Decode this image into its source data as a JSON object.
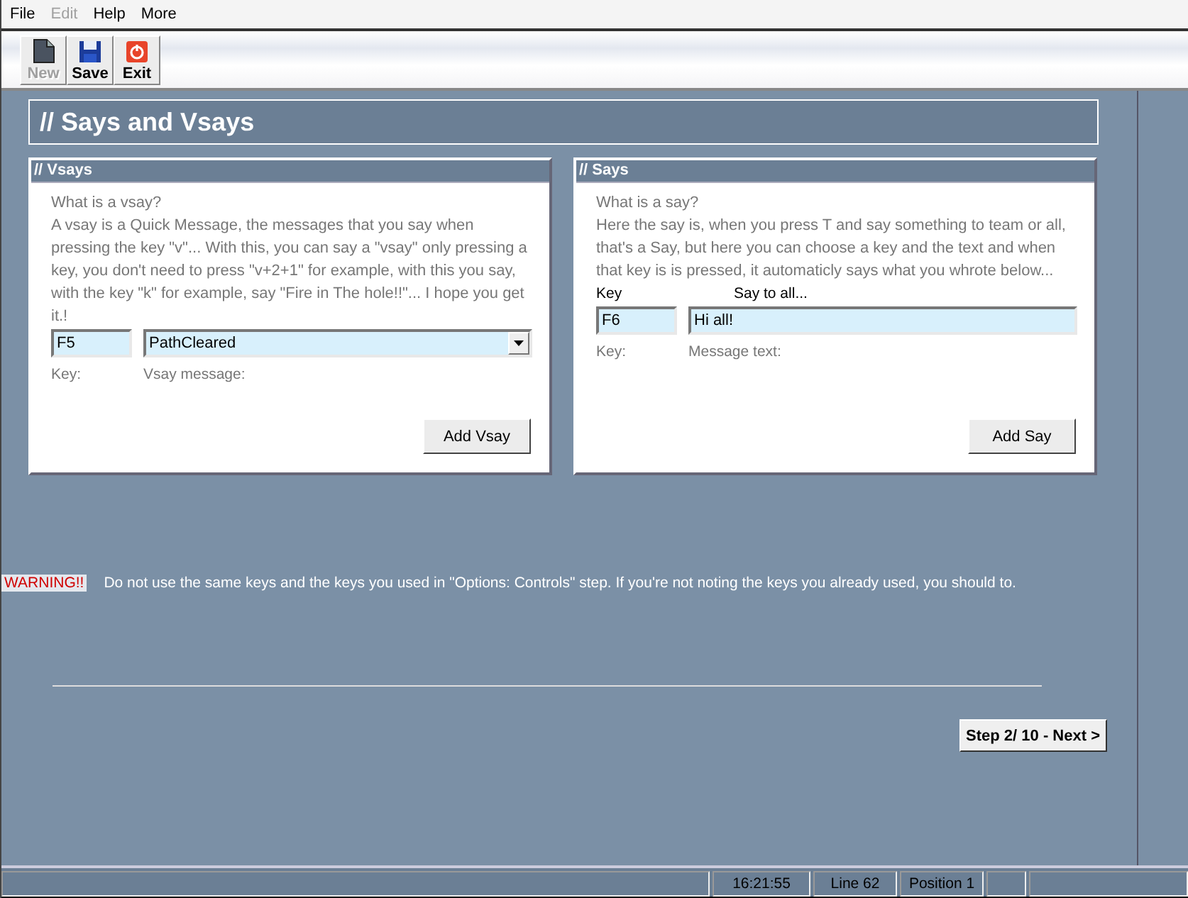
{
  "menu": [
    {
      "label": "File",
      "disabled": false
    },
    {
      "label": "Edit",
      "disabled": true
    },
    {
      "label": "Help",
      "disabled": false
    },
    {
      "label": "More",
      "disabled": false
    }
  ],
  "toolbar": [
    {
      "label": "New",
      "kind": "new",
      "disabled": true
    },
    {
      "label": "Save",
      "kind": "save",
      "disabled": false
    },
    {
      "label": "Exit",
      "kind": "exit",
      "disabled": false
    }
  ],
  "page_title": "// Says and Vsays",
  "vsays": {
    "title": "// Vsays",
    "question": "What is a vsay?",
    "text": "A vsay is a Quick Message, the messages that you say when pressing the key \"v\"... With this, you can say a \"vsay\" only pressing a key, you don't need to press \"v+2+1\" for example, with this you say, with the key \"k\" for example, say \"Fire in The hole!!\"... I hope you get it.!",
    "key_value": "F5",
    "message_value": "PathCleared",
    "key_caption": "Key:",
    "message_caption": "Vsay message:",
    "button": "Add Vsay"
  },
  "says": {
    "title": "// Says",
    "question": "What is a say?",
    "text": "Here the say is, when you press T and say something to team or all, that's a Say, but here you can choose a key and the text and when that key is is pressed, it automaticly says what you whrote below...",
    "key_label": "Key",
    "message_label": "Say to all...",
    "key_value": "F6",
    "message_value": "Hi all!",
    "key_caption": "Key:",
    "message_caption": "Message text:",
    "button": "Add Say"
  },
  "warning": {
    "label": "WARNING!!",
    "text": "Do not use the same keys and the keys you used in \"Options: Controls\" step. If you're not noting the keys you already used, you should to."
  },
  "next_button": "Step 2/ 10 - Next >",
  "status_bar": [
    "16:21:55",
    "Line 62",
    "Position 1"
  ]
}
